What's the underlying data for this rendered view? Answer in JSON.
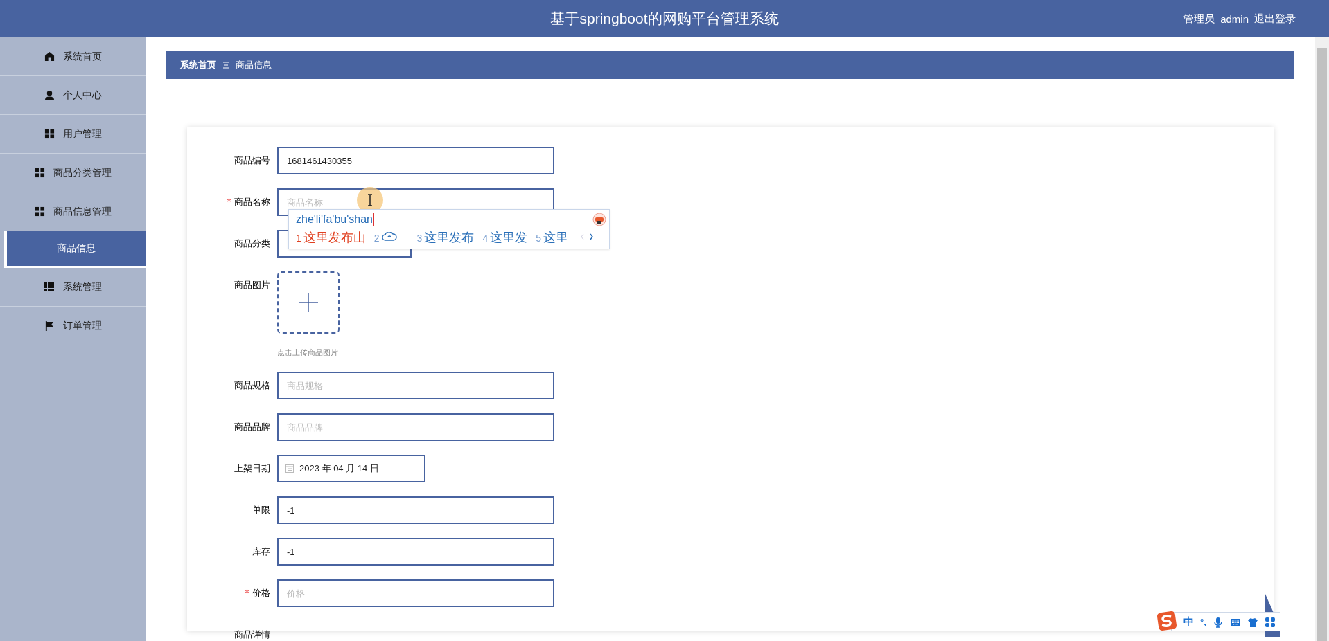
{
  "header": {
    "title": "基于springboot的网购平台管理系统",
    "user_role": "管理员",
    "user_name": "admin",
    "logout": "退出登录"
  },
  "sidebar": {
    "items": [
      {
        "label": "系统首页",
        "kind": "menu",
        "selected": false
      },
      {
        "label": "个人中心",
        "kind": "menu",
        "selected": false
      },
      {
        "label": "用户管理",
        "kind": "menu",
        "selected": false
      },
      {
        "label": "商品分类管理",
        "kind": "menu",
        "selected": false
      },
      {
        "label": "商品信息管理",
        "kind": "menu",
        "selected": false
      },
      {
        "label": "商品信息",
        "kind": "submenu",
        "selected": true
      },
      {
        "label": "系统管理",
        "kind": "menu",
        "selected": false
      },
      {
        "label": "订单管理",
        "kind": "menu",
        "selected": false
      }
    ]
  },
  "breadcrumb": [
    "系统首页",
    "商品信息"
  ],
  "form": {
    "fields": [
      {
        "kind": "input",
        "label": "商品编号",
        "required": false,
        "value": "1681461430355"
      },
      {
        "kind": "input",
        "label": "商品名称",
        "required": true,
        "placeholder": "商品名称"
      },
      {
        "kind": "select",
        "label": "商品分类",
        "required": false
      },
      {
        "kind": "upload",
        "label": "商品图片",
        "required": false,
        "hint": "点击上传商品图片"
      },
      {
        "kind": "input",
        "label": "商品规格",
        "required": false,
        "placeholder": "商品规格"
      },
      {
        "kind": "input",
        "label": "商品品牌",
        "required": false,
        "placeholder": "商品品牌"
      },
      {
        "kind": "date",
        "label": "上架日期",
        "required": false,
        "value": "2023 年 04 月 14 日"
      },
      {
        "kind": "input",
        "label": "单限",
        "required": false,
        "value": "-1"
      },
      {
        "kind": "input",
        "label": "库存",
        "required": false,
        "value": "-1"
      },
      {
        "kind": "input",
        "label": "价格",
        "required": true,
        "placeholder": "价格"
      },
      {
        "kind": "cut",
        "label": "商品详情",
        "required": false
      }
    ]
  },
  "ime": {
    "composition": "zhe'li'fa'bu'shan",
    "candidates": [
      {
        "index": "1",
        "kind": "text",
        "text": "这里发布山",
        "selected": true
      },
      {
        "index": "2",
        "kind": "cloud",
        "selected": false
      },
      {
        "index": "3",
        "kind": "text",
        "text": "这里发布",
        "selected": false
      },
      {
        "index": "4",
        "kind": "text",
        "text": "这里发",
        "selected": false
      },
      {
        "index": "5",
        "kind": "text",
        "text": "这里",
        "selected": false
      }
    ]
  },
  "ime_toolbar": {
    "mode": "中",
    "punctuation": "°,"
  }
}
